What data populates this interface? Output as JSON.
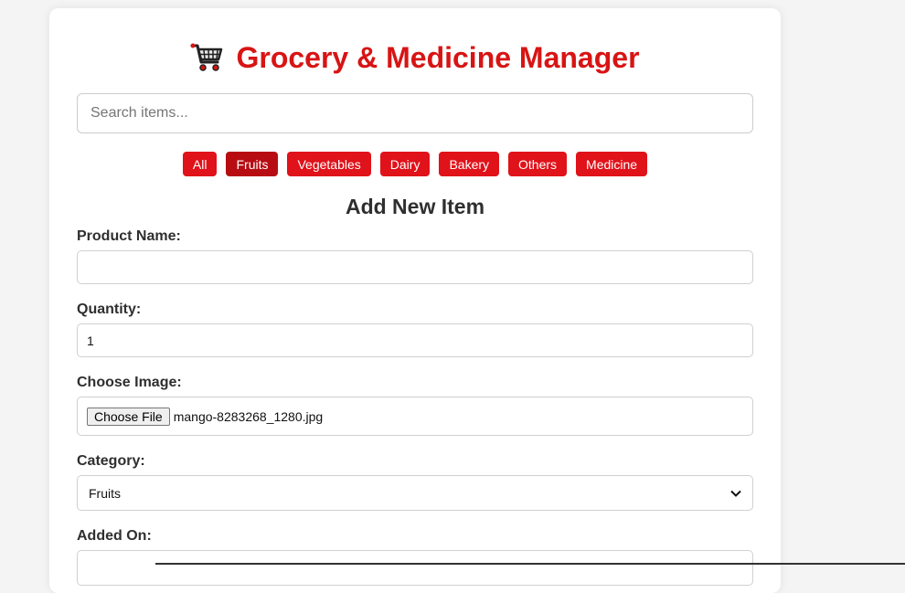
{
  "header": {
    "title": "Grocery & Medicine Manager",
    "icon": "shopping-cart-icon",
    "title_color": "#d81414"
  },
  "search": {
    "placeholder": "Search items...",
    "value": ""
  },
  "filters": {
    "items": [
      "All",
      "Fruits",
      "Vegetables",
      "Dairy",
      "Bakery",
      "Others",
      "Medicine"
    ],
    "active": "Fruits",
    "color": "#e0121a"
  },
  "form": {
    "title": "Add New Item",
    "product_name": {
      "label": "Product Name:",
      "value": ""
    },
    "quantity": {
      "label": "Quantity:",
      "value": "1"
    },
    "image": {
      "label": "Choose Image:",
      "button": "Choose File",
      "filename": "mango-8283268_1280.jpg"
    },
    "category": {
      "label": "Category:",
      "value": "Fruits"
    },
    "added_on": {
      "label": "Added On:",
      "value": ""
    }
  }
}
